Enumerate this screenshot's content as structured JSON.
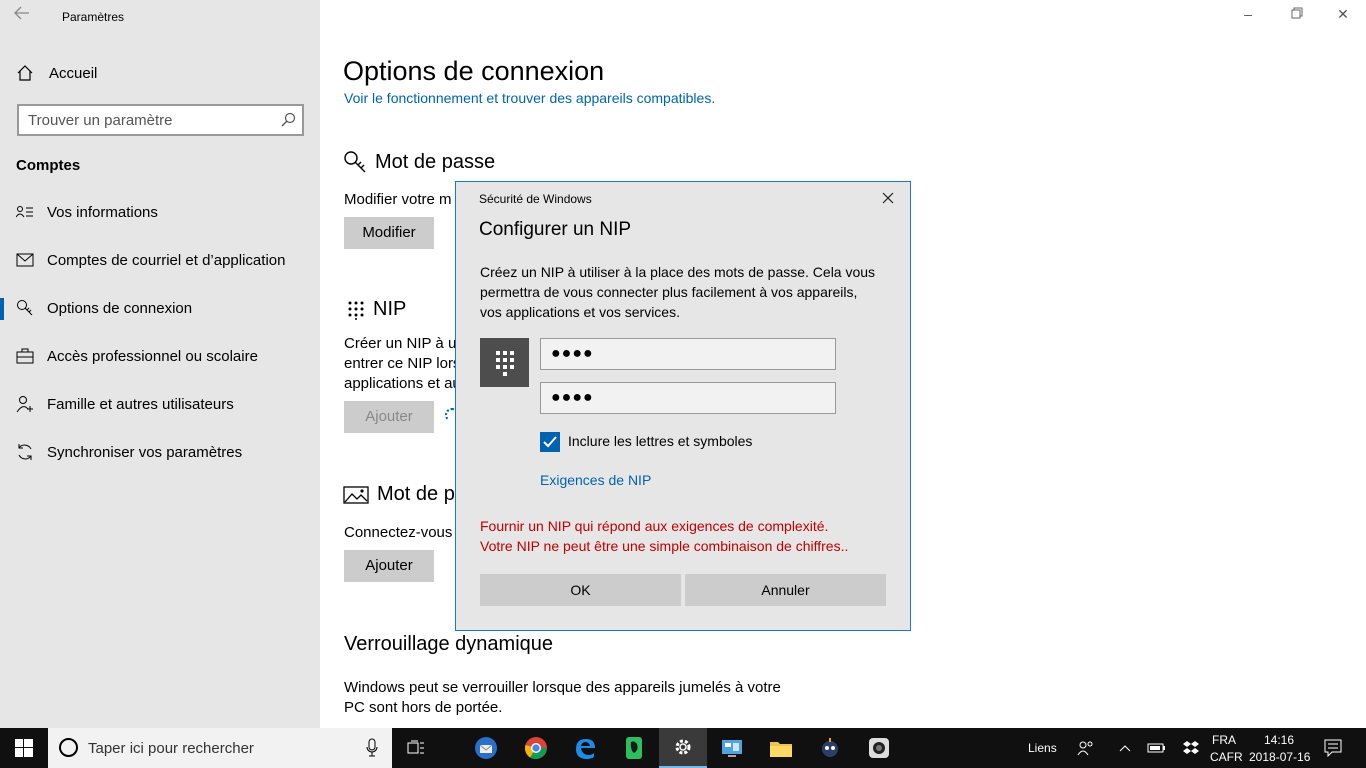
{
  "window": {
    "title": "Paramètres"
  },
  "sidebar": {
    "home_label": "Accueil",
    "search_placeholder": "Trouver un paramètre",
    "section_label": "Comptes",
    "items": [
      {
        "label": "Vos informations",
        "icon": "person-card-icon"
      },
      {
        "label": "Comptes de courriel et d’application",
        "icon": "mail-icon"
      },
      {
        "label": "Options de connexion",
        "icon": "key-icon"
      },
      {
        "label": "Accès professionnel ou scolaire",
        "icon": "briefcase-icon"
      },
      {
        "label": "Famille et autres utilisateurs",
        "icon": "person-add-icon"
      },
      {
        "label": "Synchroniser vos paramètres",
        "icon": "sync-icon"
      }
    ]
  },
  "main": {
    "title": "Options de connexion",
    "top_link": "Voir le fonctionnement et trouver des appareils compatibles.",
    "password": {
      "heading": "Mot de passe",
      "desc": "Modifier votre m",
      "button": "Modifier"
    },
    "pin": {
      "heading": "NIP",
      "desc_lines": [
        "Créer un NIP à ut",
        "entrer ce NIP lors",
        "applications et au"
      ],
      "button": "Ajouter"
    },
    "picture": {
      "heading": "Mot de p",
      "desc": "Connectez-vous",
      "button": "Ajouter"
    },
    "dynamic_lock": {
      "heading": "Verrouillage dynamique",
      "desc_lines": [
        "Windows peut se verrouiller lorsque des appareils jumelés à votre",
        "PC sont hors de portée."
      ]
    }
  },
  "dialog": {
    "caption": "Sécurité de Windows",
    "title": "Configurer un NIP",
    "description": "Créez un NIP à utiliser à la place des mots de passe. Cela vous permettra de vous connecter plus facilement à vos appareils, vos applications et vos services.",
    "pin_value": "●●●●",
    "confirm_value": "●●●●",
    "checkbox_label": "Inclure les lettres et symboles",
    "checkbox_checked": true,
    "requirements_link": "Exigences de NIP",
    "error_lines": [
      "Fournir un NIP qui répond aux exigences de complexité.",
      "Votre NIP ne peut être une simple combinaison de chiffres.."
    ],
    "ok_label": "OK",
    "cancel_label": "Annuler"
  },
  "taskbar": {
    "search_placeholder": "Taper ici pour rechercher",
    "pinned": [
      "thunderbird-icon",
      "chrome-icon",
      "edge-icon",
      "evernote-icon",
      "settings-icon",
      "control-panel-icon",
      "file-explorer-icon",
      "app-icon",
      "camera-app-icon"
    ],
    "links_label": "Liens",
    "lang_line1": "FRA",
    "lang_line2": "CAFR",
    "time": "14:16",
    "date": "2018-07-16"
  },
  "colors": {
    "accent": "#0063b1",
    "error": "#c00000",
    "sidebar_bg": "#e6e6e6"
  }
}
